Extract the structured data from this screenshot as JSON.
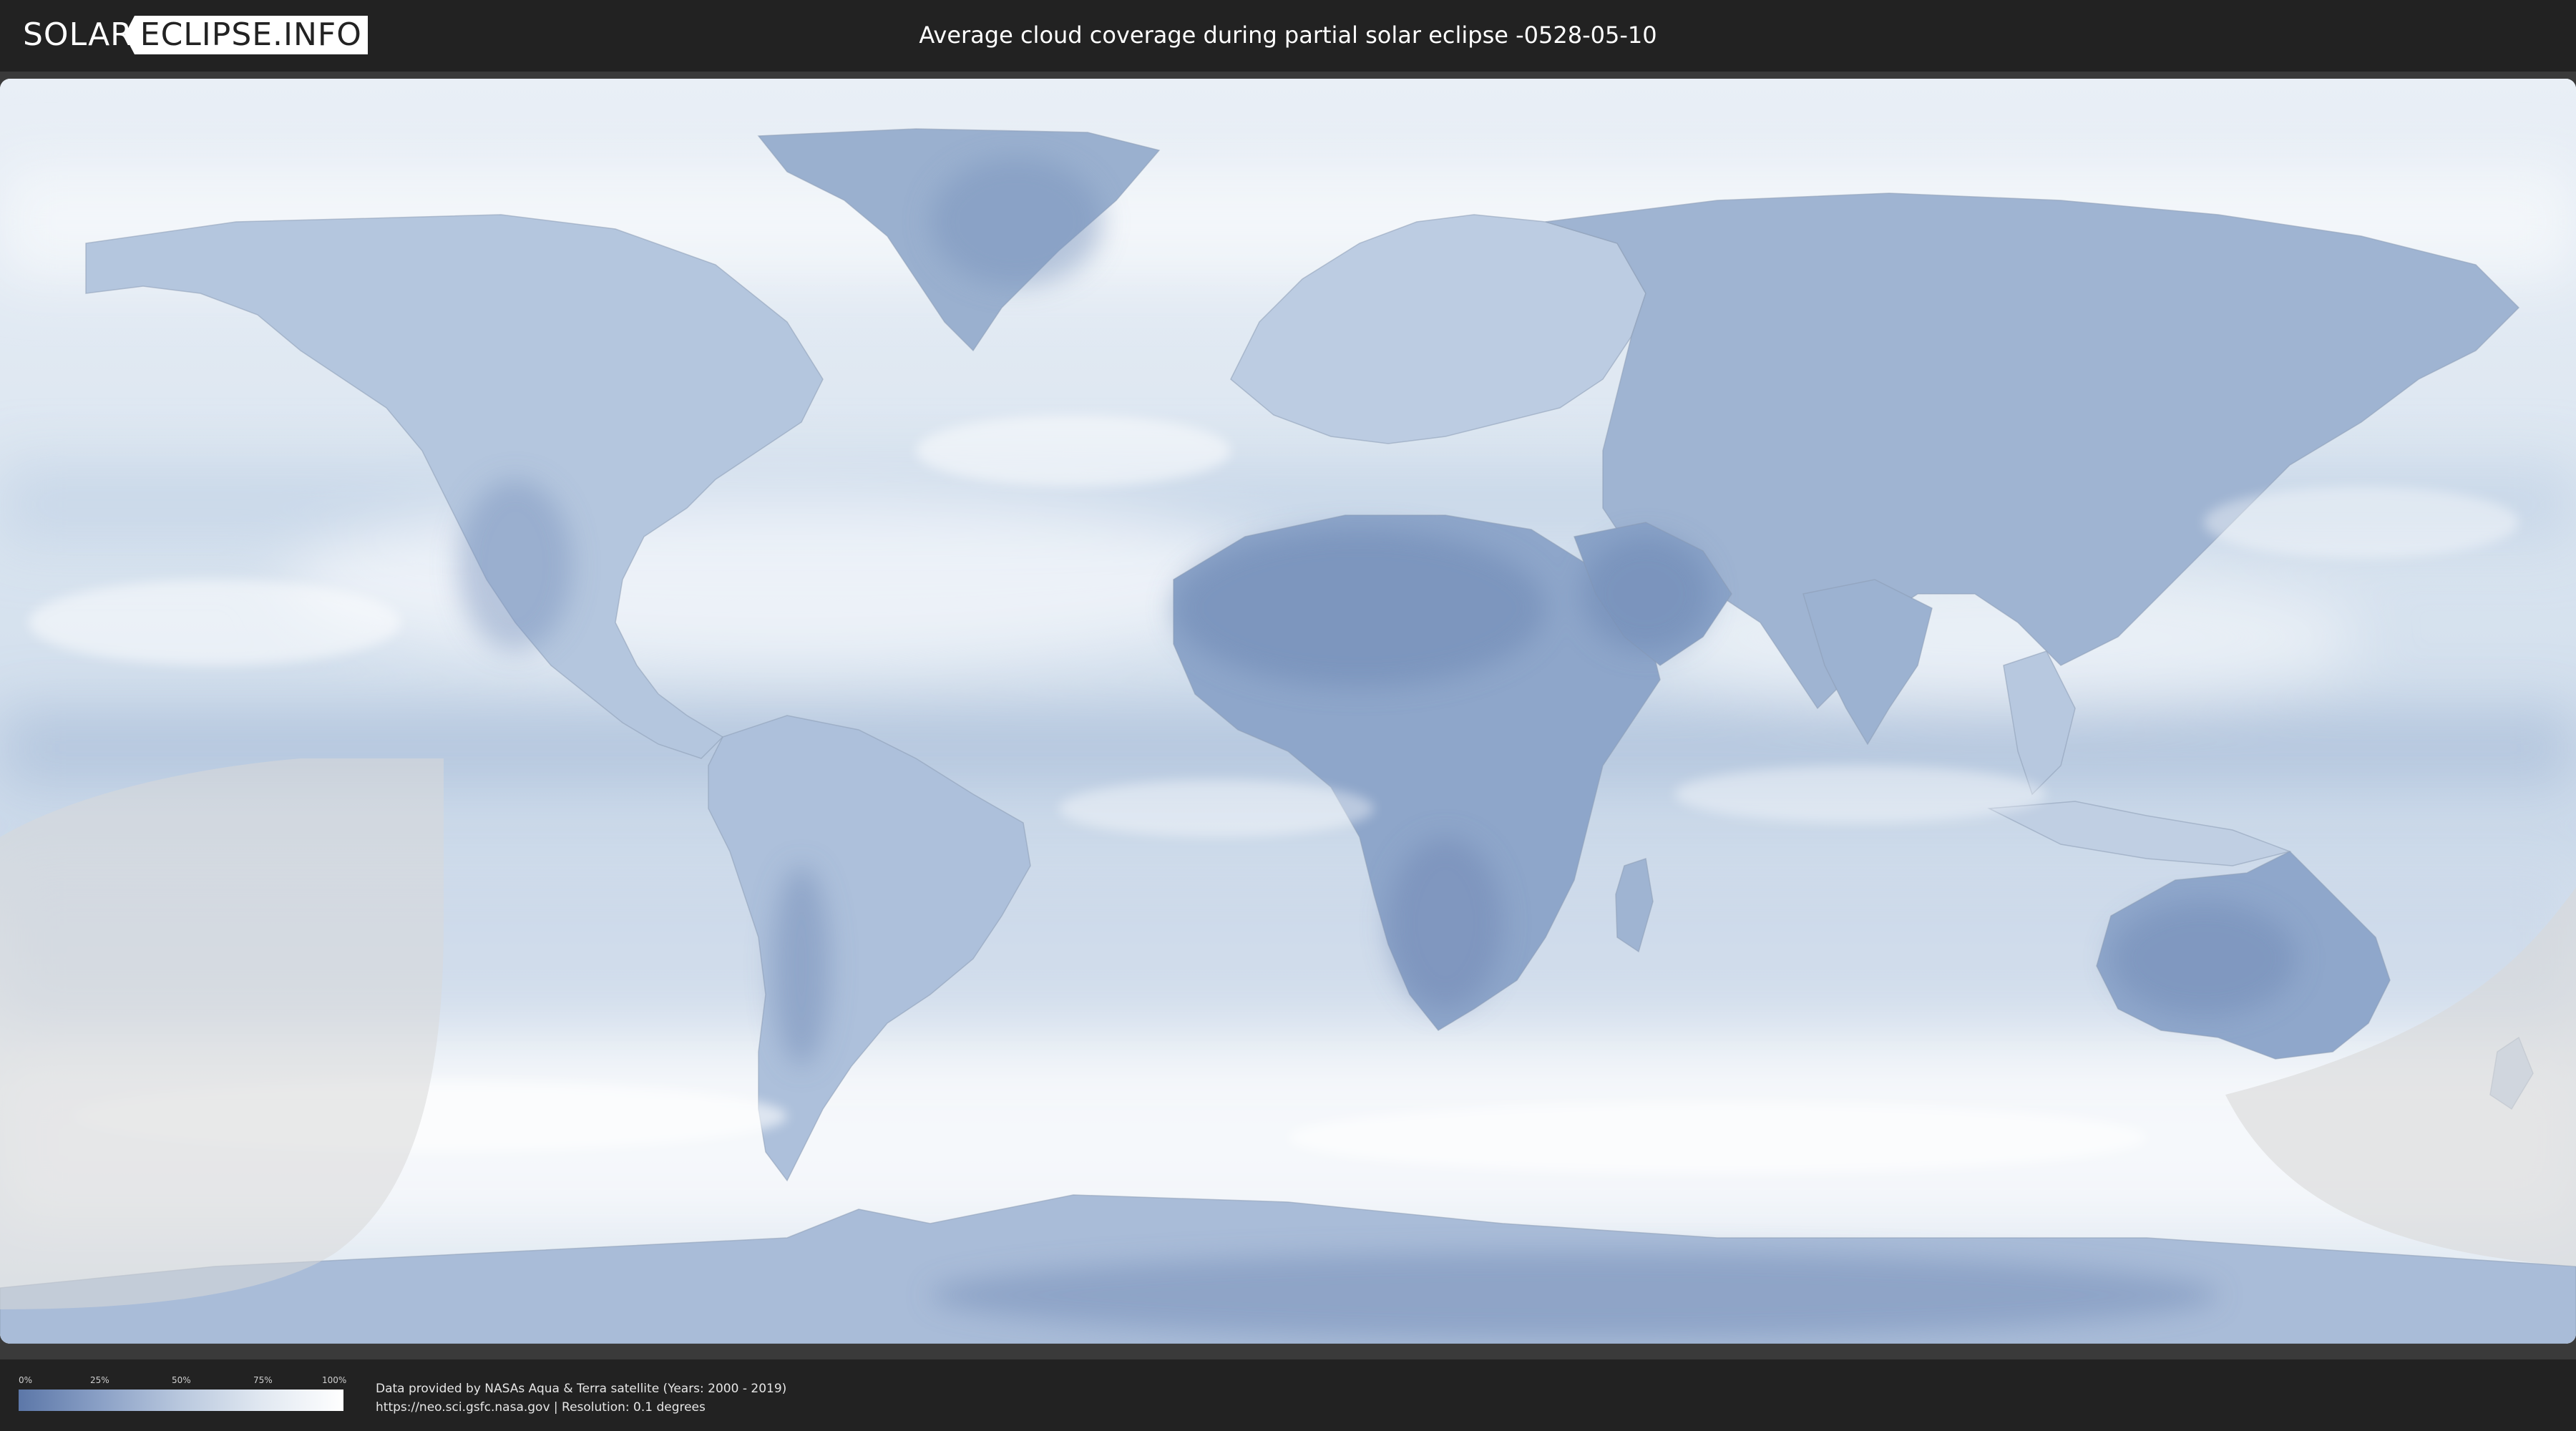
{
  "header": {
    "logo_left": "SOLAR",
    "logo_right": "ECLIPSE.INFO",
    "title": "Average cloud coverage during partial solar eclipse -0528-05-10"
  },
  "map": {
    "colors": {
      "clear": "#6f88b4",
      "cloudy": "#ffffff",
      "eclipse_zone": "#d9d9d9"
    }
  },
  "legend": {
    "ticks": [
      "0%",
      "25%",
      "50%",
      "75%",
      "100%"
    ],
    "gradient": [
      "#5c77a8",
      "#8aa0c6",
      "#b9c8de",
      "#e1e8f1",
      "#ffffff"
    ]
  },
  "footer": {
    "credit_line1": "Data provided by NASAs Aqua & Terra satellite (Years: 2000 - 2019)",
    "credit_line2": "https://neo.sci.gsfc.nasa.gov | Resolution: 0.1 degrees"
  }
}
